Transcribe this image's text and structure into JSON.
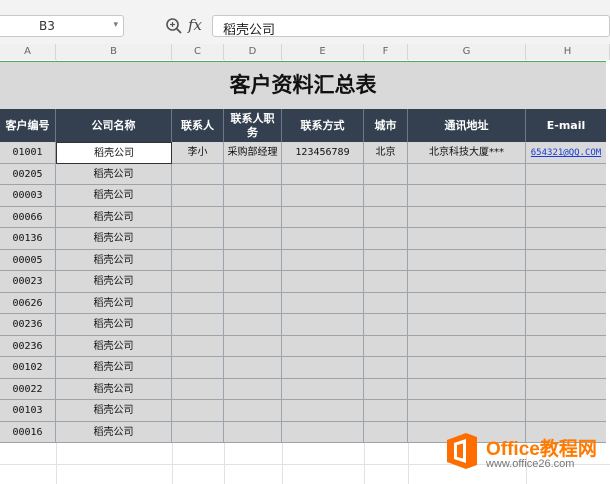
{
  "formula_bar": {
    "name_box": "B3",
    "fx_label": "fx",
    "formula_value": "稻壳公司"
  },
  "columns": [
    "A",
    "B",
    "C",
    "D",
    "E",
    "F",
    "G",
    "H"
  ],
  "table": {
    "title": "客户资料汇总表",
    "headers": [
      "客户编号",
      "公司名称",
      "联系人",
      "联系人职务",
      "联系方式",
      "城市",
      "通讯地址",
      "E-mail"
    ],
    "rows": [
      [
        "01001",
        "稻壳公司",
        "李小",
        "采购部经理",
        "123456789",
        "北京",
        "北京科技大厦***",
        "654321@QQ.COM"
      ],
      [
        "00205",
        "稻壳公司",
        "",
        "",
        "",
        "",
        "",
        ""
      ],
      [
        "00003",
        "稻壳公司",
        "",
        "",
        "",
        "",
        "",
        ""
      ],
      [
        "00066",
        "稻壳公司",
        "",
        "",
        "",
        "",
        "",
        ""
      ],
      [
        "00136",
        "稻壳公司",
        "",
        "",
        "",
        "",
        "",
        ""
      ],
      [
        "00005",
        "稻壳公司",
        "",
        "",
        "",
        "",
        "",
        ""
      ],
      [
        "00023",
        "稻壳公司",
        "",
        "",
        "",
        "",
        "",
        ""
      ],
      [
        "00626",
        "稻壳公司",
        "",
        "",
        "",
        "",
        "",
        ""
      ],
      [
        "00236",
        "稻壳公司",
        "",
        "",
        "",
        "",
        "",
        ""
      ],
      [
        "00236",
        "稻壳公司",
        "",
        "",
        "",
        "",
        "",
        ""
      ],
      [
        "00102",
        "稻壳公司",
        "",
        "",
        "",
        "",
        "",
        ""
      ],
      [
        "00022",
        "稻壳公司",
        "",
        "",
        "",
        "",
        "",
        ""
      ],
      [
        "00103",
        "稻壳公司",
        "",
        "",
        "",
        "",
        "",
        ""
      ],
      [
        "00016",
        "稻壳公司",
        "",
        "",
        "",
        "",
        "",
        ""
      ]
    ]
  },
  "watermark": {
    "title": "Office教程网",
    "url": "www.office26.com"
  },
  "colors": {
    "header_bg": "#344050",
    "table_bg": "#d9d9d9",
    "selection_border": "#4caf50",
    "link": "#1a3cd8",
    "brand": "#ff7a00"
  }
}
